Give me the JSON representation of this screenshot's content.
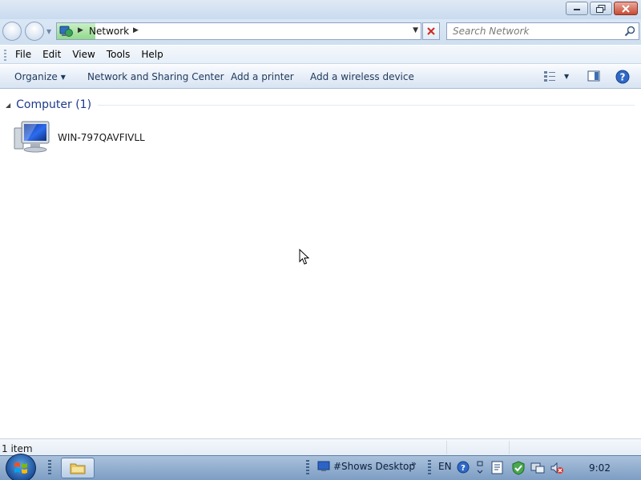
{
  "window": {
    "buttons": {
      "minimize": "minimize",
      "maximize": "restore",
      "close": "close"
    }
  },
  "address_bar": {
    "location": "Network",
    "search_placeholder": "Search Network"
  },
  "menu": {
    "items": [
      "File",
      "Edit",
      "View",
      "Tools",
      "Help"
    ]
  },
  "command_bar": {
    "organize": "Organize",
    "network_sharing": "Network and Sharing Center",
    "add_printer": "Add a printer",
    "add_wireless": "Add a wireless device"
  },
  "content": {
    "group_title": "Computer (1)",
    "items": [
      {
        "name": "WIN-797QAVFIVLL",
        "icon": "computer-icon"
      }
    ]
  },
  "status_bar": {
    "item_count": "1 item"
  },
  "taskbar": {
    "desktop_toolbar": "#Shows Desktop",
    "language": "EN",
    "clock": "9:02"
  },
  "colors": {
    "accent": "#1e395b",
    "group_title": "#1e3a8a",
    "taskbar": "#8fadd0"
  }
}
